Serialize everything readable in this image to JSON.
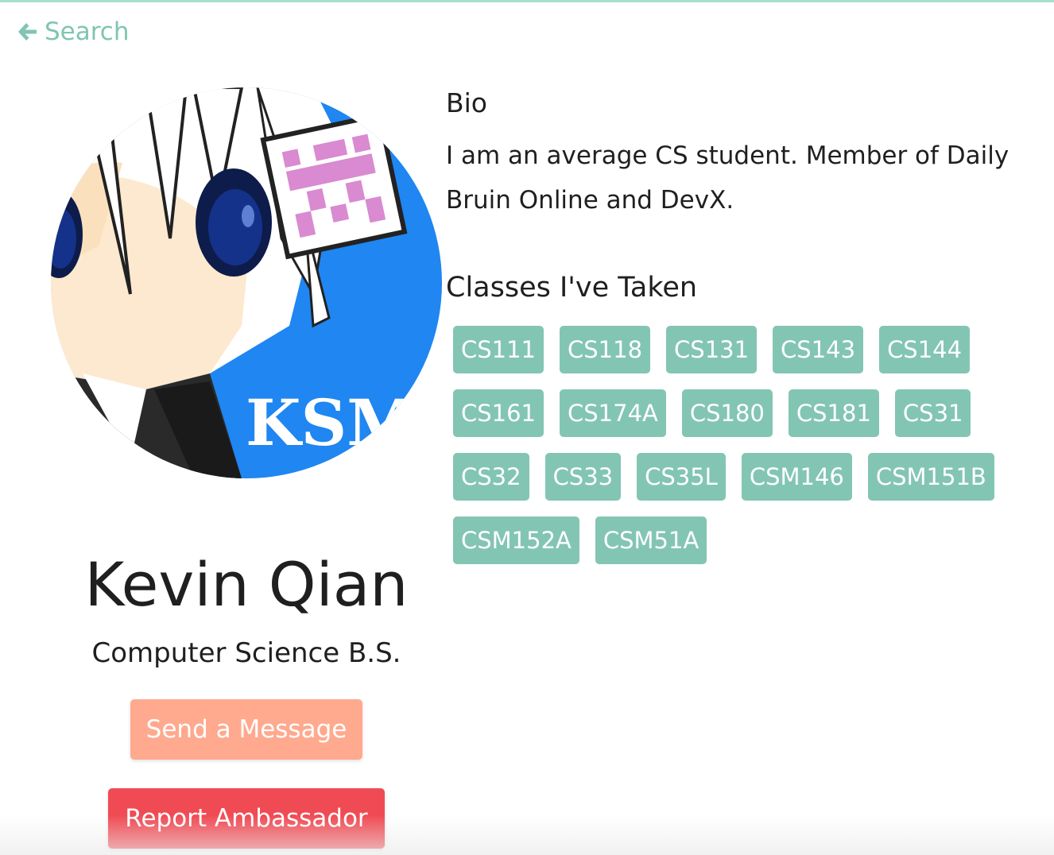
{
  "nav": {
    "back_label": "Search"
  },
  "profile": {
    "avatar_text": "KSM",
    "name": "Kevin Qian",
    "major": "Computer Science B.S.",
    "message_button": "Send a Message",
    "report_button": "Report Ambassador"
  },
  "bio": {
    "heading": "Bio",
    "text": "I am an average CS student. Member of Daily Bruin Online and DevX."
  },
  "classes": {
    "heading": "Classes I've Taken",
    "rows": [
      [
        "CS111",
        "CS118",
        "CS131",
        "CS143",
        "CS144"
      ],
      [
        "CS161",
        "CS174A",
        "CS180",
        "CS181",
        "CS31"
      ],
      [
        "CS32",
        "CS33",
        "CS35L",
        "CSM146",
        "CSM151B"
      ],
      [
        "CSM152A",
        "CSM51A"
      ]
    ]
  },
  "colors": {
    "accent": "#7fc5b2",
    "tag_bg": "#83c5b3",
    "message_button": "#ffa98e",
    "report_button": "#f04b54",
    "avatar_blue": "#1f86f2"
  }
}
